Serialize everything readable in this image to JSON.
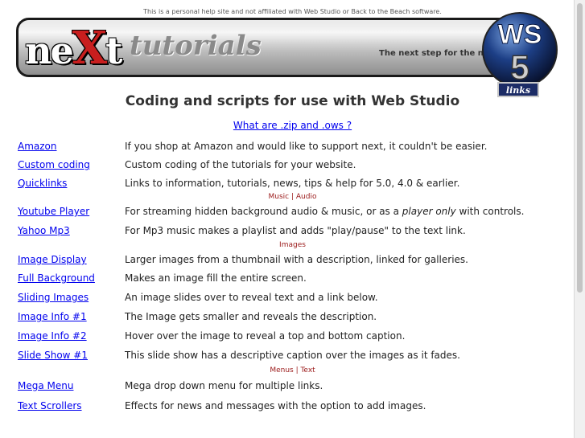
{
  "disclaimer": "This is a personal help site and not affiliated with Web Studio or Back to the Beach software.",
  "banner": {
    "logo_pre": "ne",
    "logo_x": "X",
    "logo_post": "t",
    "logo_word": "tutorials",
    "tagline": "The next step for the net",
    "badge_top": "WS",
    "badge_num": "5",
    "badge_caption": "links"
  },
  "page": {
    "title": "Coding and scripts for use with Web Studio",
    "faq_link": "What are .zip and .ows ?"
  },
  "sections": {
    "music_audio": "Music | Audio",
    "images": "Images",
    "menus_text": "Menus | Text"
  },
  "links": [
    {
      "label": "Amazon",
      "desc": "If you shop at Amazon and would like to support next, it couldn't be easier."
    },
    {
      "label": "Custom coding",
      "desc": "Custom coding of the tutorials for your website."
    },
    {
      "label": "Quicklinks",
      "desc": "Links to information, tutorials, news, tips & help for 5.0, 4.0 & earlier."
    },
    {
      "label": "Youtube Player",
      "desc_pre": "For streaming hidden background audio & music, or as a ",
      "desc_em": "player only",
      "desc_post": " with controls."
    },
    {
      "label": "Yahoo Mp3",
      "desc": "For Mp3 music makes a playlist and adds \"play/pause\" to the text link."
    },
    {
      "label": "Image Display",
      "desc": "Larger images from a thumbnail with a description, linked for galleries."
    },
    {
      "label": "Full Background",
      "desc": "Makes an image fill the entire screen."
    },
    {
      "label": "Sliding Images",
      "desc": "An image slides over to reveal text and a link below."
    },
    {
      "label": "Image Info #1",
      "desc": "The Image gets smaller and reveals the description."
    },
    {
      "label": "Image Info #2",
      "desc": "Hover over the image to reveal a top and bottom caption."
    },
    {
      "label": "Slide Show #1",
      "desc": "This slide show has a descriptive caption over the images as it fades."
    },
    {
      "label": "Mega Menu",
      "desc": "Mega drop down menu for multiple links."
    },
    {
      "label": "Text Scrollers",
      "desc": "Effects for news and messages with the option to add images."
    }
  ]
}
